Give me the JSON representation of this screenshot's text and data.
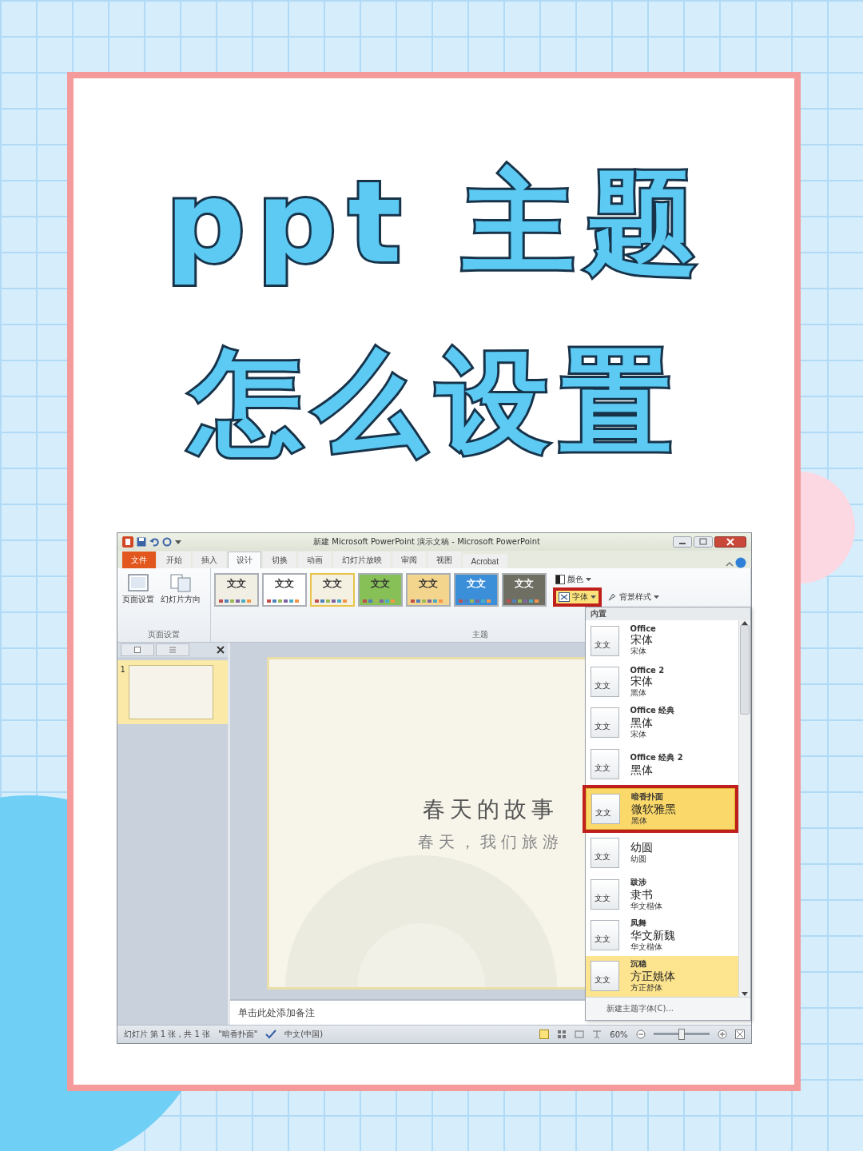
{
  "headline": {
    "lines": [
      "ppt 主题",
      "怎么设置"
    ]
  },
  "window": {
    "title": "新建 Microsoft PowerPoint 演示文稿 - Microsoft PowerPoint"
  },
  "tabs": [
    {
      "label": "文件",
      "kind": "file",
      "selected": false
    },
    {
      "label": "开始",
      "kind": "tab",
      "selected": false
    },
    {
      "label": "插入",
      "kind": "tab",
      "selected": false
    },
    {
      "label": "设计",
      "kind": "tab",
      "selected": true
    },
    {
      "label": "切换",
      "kind": "tab",
      "selected": false
    },
    {
      "label": "动画",
      "kind": "tab",
      "selected": false
    },
    {
      "label": "幻灯片放映",
      "kind": "tab",
      "selected": false
    },
    {
      "label": "审阅",
      "kind": "tab",
      "selected": false
    },
    {
      "label": "视图",
      "kind": "tab",
      "selected": false
    },
    {
      "label": "Acrobat",
      "kind": "tab",
      "selected": false
    }
  ],
  "ribbon": {
    "page_setup": {
      "buttons": [
        {
          "label": "页面设置",
          "kind": "page"
        },
        {
          "label": "幻灯片方向",
          "kind": "orientation"
        }
      ],
      "group_label": "页面设置"
    },
    "themes": {
      "items": [
        {
          "sample": "文文",
          "color": "#f1eee4",
          "selected": false
        },
        {
          "sample": "文文",
          "color": "#ffffff",
          "selected": false
        },
        {
          "sample": "文文",
          "color": "#f4f0e2",
          "selected": true
        },
        {
          "sample": "文文",
          "color": "#86c056",
          "selected": false
        },
        {
          "sample": "文文",
          "color": "#f3d58e",
          "selected": false
        },
        {
          "sample": "文文",
          "color": "#3b8fd9",
          "selected": false
        },
        {
          "sample": "文文",
          "color": "#6f6e63",
          "selected": false
        }
      ],
      "options": [
        {
          "label": "颜色",
          "kind": "colors",
          "highlighted": false
        },
        {
          "label": "字体",
          "kind": "fonts",
          "highlighted": true
        },
        {
          "label": "背景样式",
          "kind": "background",
          "highlighted": false
        }
      ],
      "group_label": "主题"
    }
  },
  "slide_panel": {
    "slides": [
      {
        "number": "1",
        "selected": true
      }
    ]
  },
  "slide": {
    "title": "春天的故事",
    "subtitle": "春天，我们旅游"
  },
  "notes": {
    "placeholder": "单击此处添加备注"
  },
  "font_menu": {
    "section": "内置",
    "items": [
      {
        "sample": "文文",
        "name": "Office",
        "heading_font": "宋体",
        "body_font": "宋体",
        "selected": false,
        "hovered": false,
        "highlighted": false
      },
      {
        "sample": "文文",
        "name": "Office 2",
        "heading_font": "宋体",
        "body_font": "黑体",
        "selected": false,
        "hovered": false,
        "highlighted": false
      },
      {
        "sample": "文文",
        "name": "Office 经典",
        "heading_font": "黑体",
        "body_font": "宋体",
        "selected": false,
        "hovered": false,
        "highlighted": false
      },
      {
        "sample": "文文",
        "name": "Office 经典 2",
        "heading_font": "黑体",
        "selected": false,
        "hovered": false,
        "highlighted": false
      },
      {
        "sample": "文文",
        "name": "暗香扑面",
        "heading_font": "微软雅黑",
        "body_font": "黑体",
        "selected": true,
        "hovered": false,
        "highlighted": true
      },
      {
        "sample": "文文",
        "heading_font": "幼圆",
        "body_font": "幼圆",
        "selected": false,
        "hovered": false,
        "highlighted": false
      },
      {
        "sample": "文文",
        "name": "跋涉",
        "heading_font": "隶书",
        "body_font": "华文楷体",
        "selected": false,
        "hovered": false,
        "highlighted": false
      },
      {
        "sample": "文文",
        "name": "凤舞",
        "heading_font": "华文新魏",
        "body_font": "华文楷体",
        "selected": false,
        "hovered": false,
        "highlighted": false
      },
      {
        "sample": "文文",
        "name": "沉稳",
        "heading_font": "方正姚体",
        "body_font": "方正舒体",
        "selected": false,
        "hovered": true,
        "highlighted": false
      }
    ],
    "footer": "新建主题字体(C)..."
  },
  "status_bar": {
    "slide_info": "幻灯片 第 1 张，共 1 张",
    "theme": "\"暗香扑面\"",
    "language": "中文(中国)",
    "zoom": "60%",
    "zoom_slider": {
      "level": 0.5
    }
  }
}
